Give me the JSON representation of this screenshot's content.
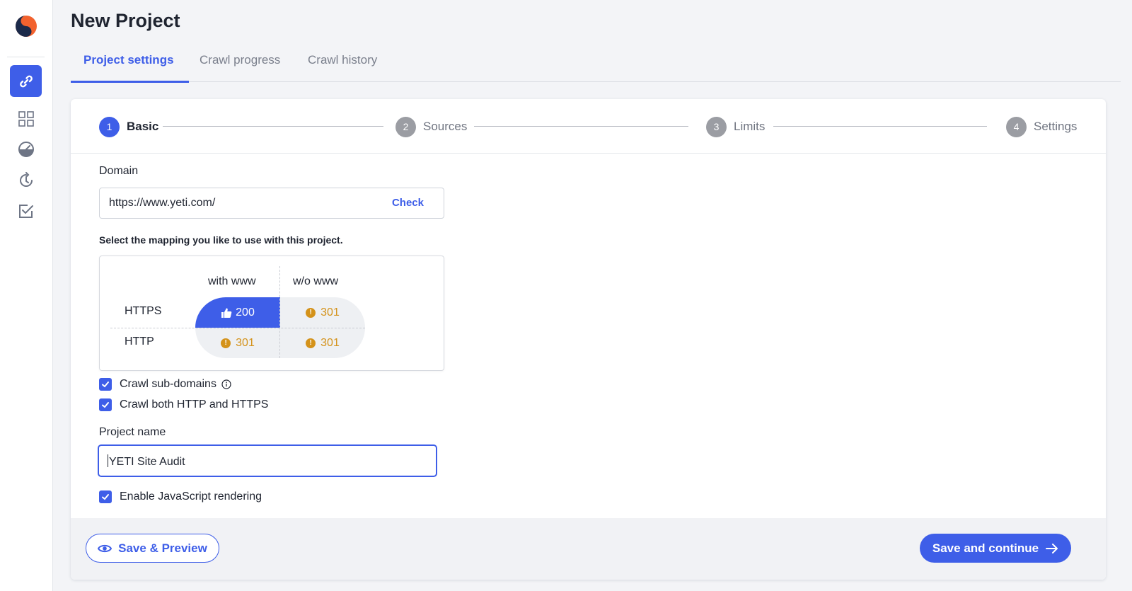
{
  "app": {
    "page_title": "New Project"
  },
  "sidebar": {
    "items": [
      {
        "icon": "link-icon",
        "active": true
      },
      {
        "icon": "grid-icon",
        "active": false
      },
      {
        "icon": "gauge-icon",
        "active": false
      },
      {
        "icon": "history-icon",
        "active": false
      },
      {
        "icon": "checkbox-icon",
        "active": false
      }
    ]
  },
  "tabs": [
    {
      "label": "Project settings",
      "active": true
    },
    {
      "label": "Crawl progress",
      "active": false
    },
    {
      "label": "Crawl history",
      "active": false
    }
  ],
  "stepper": {
    "steps": [
      {
        "num": "1",
        "label": "Basic",
        "active": true
      },
      {
        "num": "2",
        "label": "Sources",
        "active": false
      },
      {
        "num": "3",
        "label": "Limits",
        "active": false
      },
      {
        "num": "4",
        "label": "Settings",
        "active": false
      }
    ]
  },
  "domain": {
    "label": "Domain",
    "value": "https://www.yeti.com/",
    "check_label": "Check"
  },
  "mapping": {
    "hint": "Select the mapping you like to use with this project.",
    "columns": [
      "with www",
      "w/o www"
    ],
    "rows": [
      {
        "label": "HTTPS",
        "cells": [
          {
            "code": "200",
            "selected": true
          },
          {
            "code": "301",
            "selected": false
          }
        ]
      },
      {
        "label": "HTTP",
        "cells": [
          {
            "code": "301",
            "selected": false
          },
          {
            "code": "301",
            "selected": false
          }
        ]
      }
    ],
    "warn_symbol": "!"
  },
  "options": {
    "crawl_subdomains": {
      "label": "Crawl sub-domains",
      "checked": true
    },
    "crawl_both": {
      "label": "Crawl both HTTP and HTTPS",
      "checked": true
    },
    "js_rendering": {
      "label": "Enable JavaScript rendering",
      "checked": true
    }
  },
  "project_name": {
    "label": "Project name",
    "value": "YETI Site Audit"
  },
  "footer": {
    "preview_label": "Save & Preview",
    "continue_label": "Save and continue"
  },
  "colors": {
    "accent": "#3e5ee8",
    "warning": "#d4921a",
    "logo_orange": "#f2622e",
    "logo_navy": "#1b2a4a"
  }
}
